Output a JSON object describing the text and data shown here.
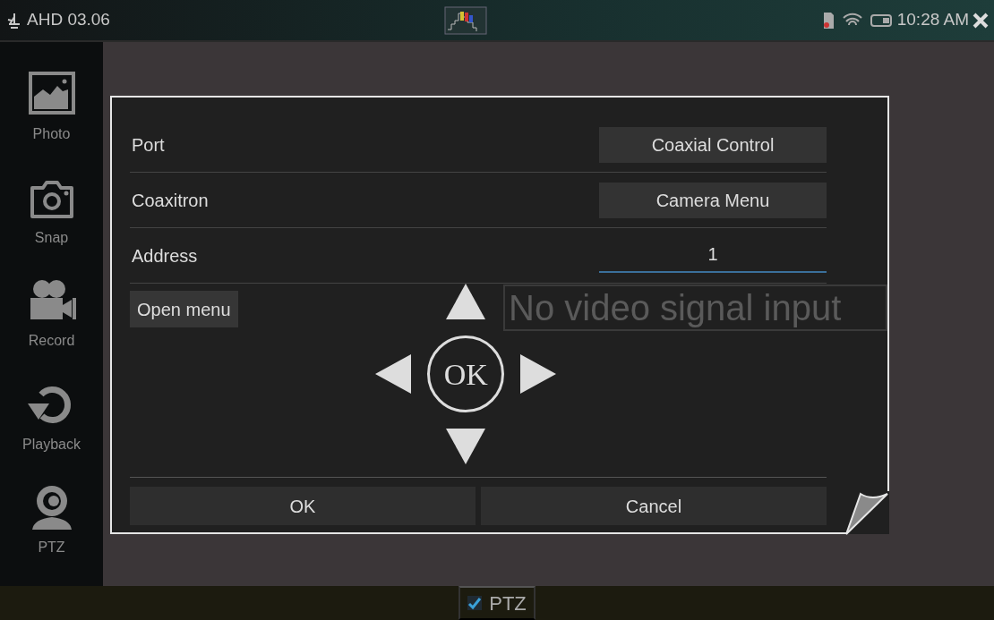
{
  "status_bar": {
    "mode": "AHD 03.06",
    "time": "10:28 AM"
  },
  "sidebar": {
    "items": [
      {
        "label": "Photo",
        "kind": "photo"
      },
      {
        "label": "Snap",
        "kind": "snap"
      },
      {
        "label": "Record",
        "kind": "record"
      },
      {
        "label": "Playback",
        "kind": "playback"
      },
      {
        "label": "PTZ",
        "kind": "ptz"
      }
    ]
  },
  "video": {
    "message": "No video signal input"
  },
  "dialog": {
    "fields": [
      {
        "label": "Port",
        "kind": "select",
        "value": "Coaxial Control"
      },
      {
        "label": "Coaxitron",
        "kind": "select",
        "value": "Camera Menu"
      },
      {
        "label": "Address",
        "kind": "input",
        "value": "1"
      }
    ],
    "open_menu": "Open menu",
    "dpad_center": "OK",
    "buttons": [
      "OK",
      "Cancel"
    ]
  },
  "bottom_bar": {
    "ptz": {
      "label": "PTZ",
      "checked": true
    }
  }
}
